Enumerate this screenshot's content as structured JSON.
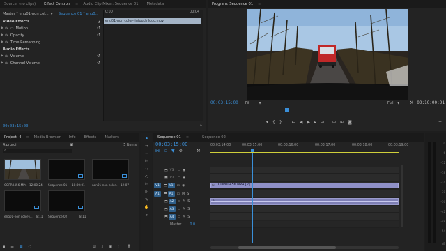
{
  "source_panel": {
    "tabs": [
      {
        "label": "Source: (no clips)"
      },
      {
        "label": "Effect Controls",
        "active": true
      },
      {
        "label": "Audio Clip Mixer: Sequence 01"
      },
      {
        "label": "Metadata"
      }
    ],
    "menu_icon": "menu-lines-icon",
    "master_label": "Master * eng01-non col...",
    "sequence_label": "Sequence 01 * eng0...",
    "mini_timecode_start": "0:00",
    "mini_timecode_end": "00:04",
    "clip_bar_label": "eng01-non color--intouch logo.mov",
    "video_effects_header": "Video Effects",
    "video_effects": [
      {
        "name": "Motion"
      },
      {
        "name": "Opacity"
      },
      {
        "name": "Time Remapping"
      }
    ],
    "audio_effects_header": "Audio Effects",
    "audio_effects": [
      {
        "name": "Volume"
      },
      {
        "name": "Channel Volume"
      }
    ],
    "timecode": "00:03:15:00"
  },
  "program_monitor": {
    "tab_label": "Program: Sequence 01",
    "timecode_current": "00:03:15:00",
    "zoom": "Fit",
    "quality": "Full",
    "timecode_duration": "00:10:00:01",
    "transport_icons": [
      "marker-icon",
      "in-point-icon",
      "out-point-icon",
      "go-to-in-icon",
      "step-back-icon",
      "play-icon",
      "step-forward-icon",
      "go-to-out-icon",
      "lift-icon",
      "extract-icon",
      "export-frame-icon"
    ]
  },
  "project_panel": {
    "tabs": [
      {
        "label": "Project: 4",
        "active": true
      },
      {
        "label": "Media Browser"
      },
      {
        "label": "Info"
      },
      {
        "label": "Effects"
      },
      {
        "label": "Markers"
      }
    ],
    "project_file": "4.prproj",
    "items_count": "5 Items",
    "items": [
      {
        "name": "COPR0456.MP4",
        "duration": "12:00:24"
      },
      {
        "name": "Sequence 01",
        "duration": "10:00:01"
      },
      {
        "name": "non01-non color...",
        "duration": "12:07"
      },
      {
        "name": "eng01-non color-i...",
        "duration": "8:11"
      },
      {
        "name": "Sequence 02",
        "duration": "8:11"
      }
    ]
  },
  "timeline": {
    "tabs": [
      {
        "label": "Sequence 01",
        "active": true
      },
      {
        "label": "Sequence 02"
      }
    ],
    "timecode": "00:03:15:00",
    "ruler": [
      "00:03:14:00",
      "00:03:15:00",
      "00:03:16:00",
      "00:03:17:00",
      "00:03:18:00",
      "00:03:19:00"
    ],
    "video_tracks": [
      {
        "name": "V3",
        "toggle": "off"
      },
      {
        "name": "V2",
        "toggle": "off"
      },
      {
        "name": "V1",
        "toggle": "on",
        "source": "V1"
      }
    ],
    "audio_tracks": [
      {
        "name": "A1",
        "source": "A1"
      },
      {
        "name": "A2"
      },
      {
        "name": "A3"
      },
      {
        "name": "A4"
      }
    ],
    "master_label": "Master",
    "master_value": "0.0",
    "video_clip_label": "COPR0456.MP4 [V]",
    "audio_clip_label": "fx",
    "meter_scale": [
      "0",
      "-6",
      "-12",
      "-18",
      "-24",
      "-30",
      "-36",
      "-42",
      "-48",
      "-54"
    ],
    "meter_bottom": "dB"
  },
  "colors": {
    "accent_blue": "#3a8fd8",
    "clip_video": "#8f90c7",
    "clip_audio": "#7f80b6",
    "panel_bg": "#232323"
  }
}
